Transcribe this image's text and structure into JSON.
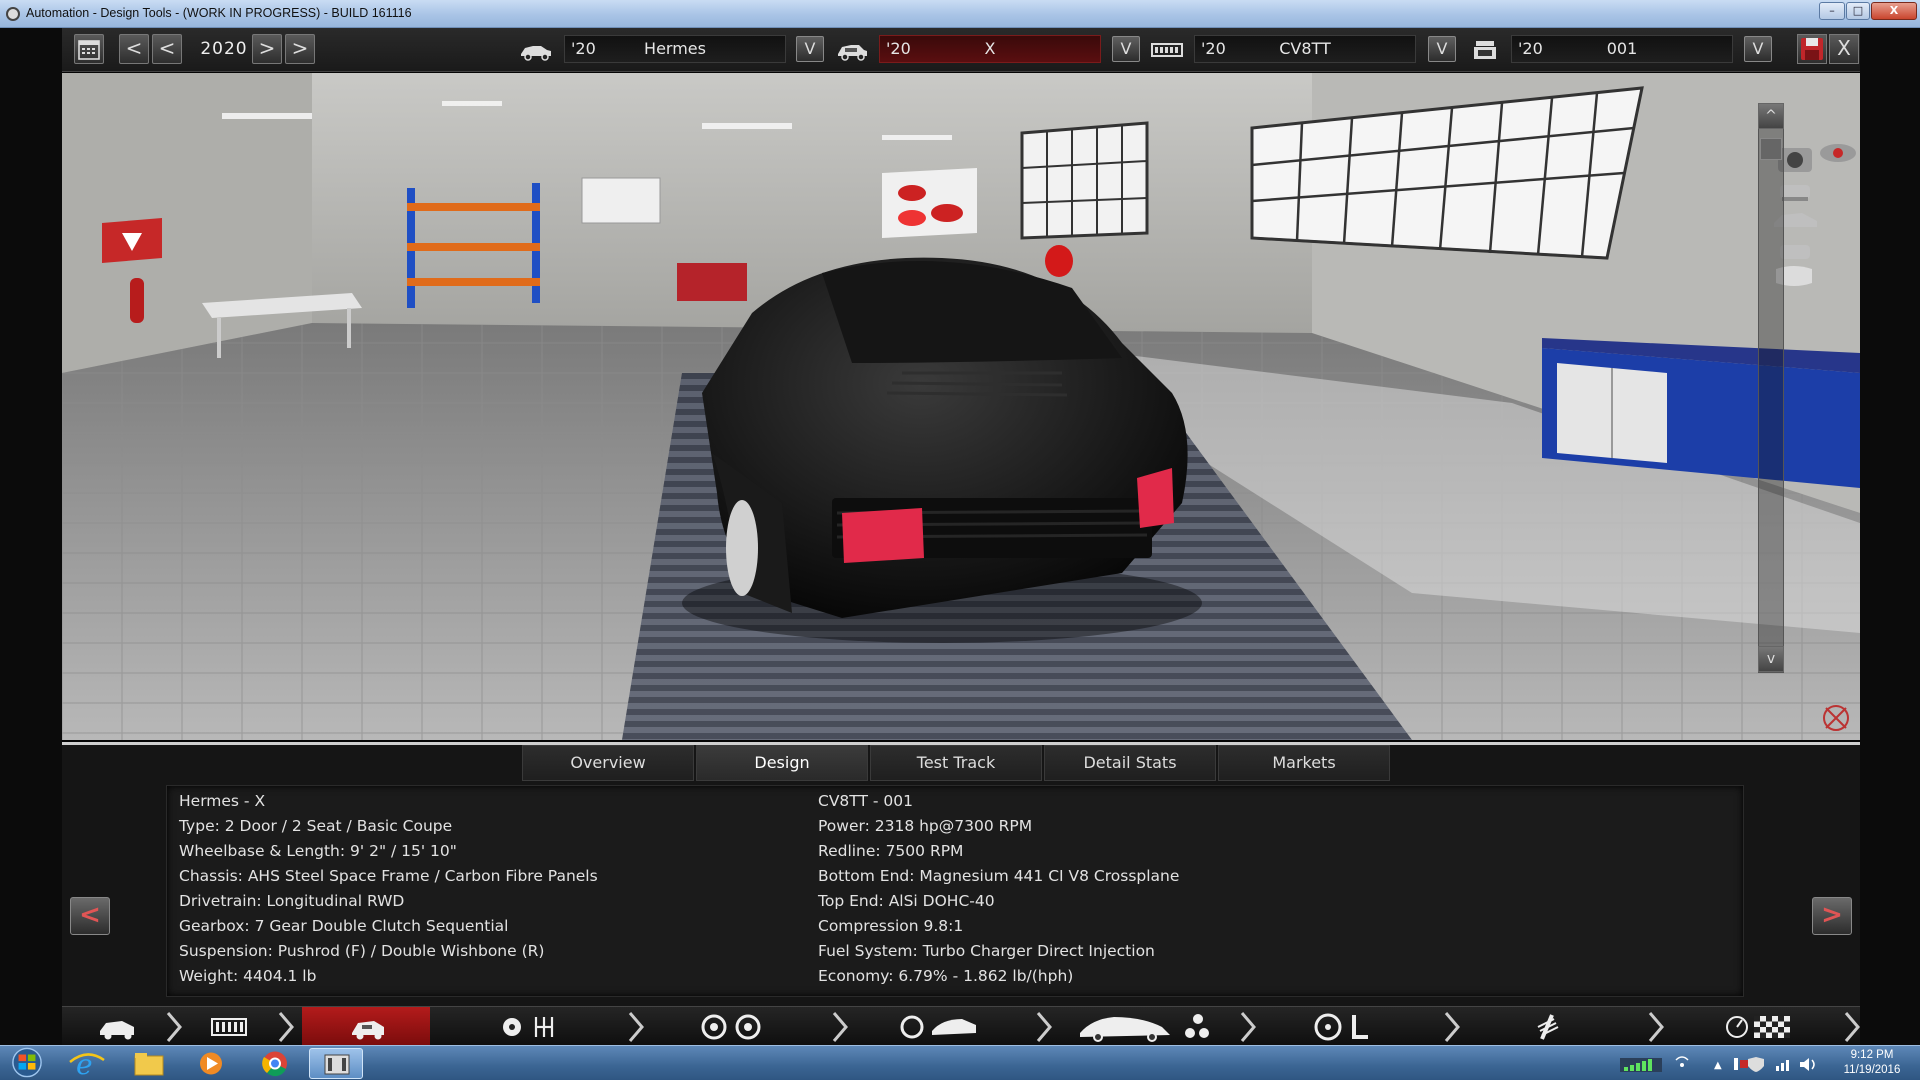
{
  "window": {
    "title": "Automation - Design Tools - (WORK IN PROGRESS) - BUILD 161116",
    "minimize_label": "–",
    "maximize_label": "□",
    "close_label": "X"
  },
  "toolbar": {
    "year": "2020",
    "prev_label": "<",
    "next_label": ">",
    "dropdown_label": "V",
    "close_label": "X",
    "selectors": [
      {
        "year": "'20",
        "name": "Hermes",
        "icon": "car-side-icon"
      },
      {
        "year": "'20",
        "name": "X",
        "icon": "car-trim-icon",
        "accent": "#5a0e10"
      },
      {
        "year": "'20",
        "name": "CV8TT",
        "icon": "engine-block-icon"
      },
      {
        "year": "'20",
        "name": "001",
        "icon": "engine-variant-icon"
      }
    ]
  },
  "viewport": {
    "scroll_up_label": "^",
    "scroll_down_label": "v"
  },
  "panel": {
    "tabs": [
      {
        "label": "Overview",
        "active": false
      },
      {
        "label": "Design",
        "active": true
      },
      {
        "label": "Test Track",
        "active": false
      },
      {
        "label": "Detail Stats",
        "active": false
      },
      {
        "label": "Markets",
        "active": false
      }
    ],
    "prev_label": "<",
    "next_label": ">",
    "car_stats": [
      "Hermes - X",
      "Type: 2 Door / 2 Seat / Basic Coupe",
      "Wheelbase & Length: 9' 2\" / 15' 10\"",
      "Chassis: AHS Steel Space Frame / Carbon Fibre Panels",
      "Drivetrain: Longitudinal RWD",
      "Gearbox: 7 Gear Double Clutch Sequential",
      "Suspension: Pushrod (F) / Double Wishbone (R)",
      "Weight: 4404.1 lb"
    ],
    "engine_stats": [
      "CV8TT - 001",
      "Power: 2318 hp@7300 RPM",
      "Redline: 7500 RPM",
      "Bottom End: Magnesium 441 CI V8 Crossplane",
      "Top End: AlSi DOHC-40",
      "Compression 9.8:1",
      "Fuel System: Turbo Charger Direct Injection",
      "Economy: 6.79% - 1.862 lb/(hph)"
    ]
  },
  "workflow": {
    "active_step": 2,
    "steps": [
      "car-model-icon",
      "engine-icon",
      "car-design-icon",
      "gearbox-icon",
      "wheels-icon",
      "body-aero-icon",
      "car-fixtures-icon",
      "interior-icon",
      "suspension-icon",
      "test-track-icon"
    ]
  },
  "taskbar": {
    "time": "9:12 PM",
    "date": "11/19/2016",
    "apps": [
      "start-orb-icon",
      "internet-explorer-icon",
      "file-explorer-icon",
      "media-player-icon",
      "chrome-icon",
      "automation-app-icon"
    ]
  },
  "colors": {
    "accent_red": "#b31b1b",
    "panel_bg": "#151515",
    "taskbar_blue": "#3b6593"
  }
}
